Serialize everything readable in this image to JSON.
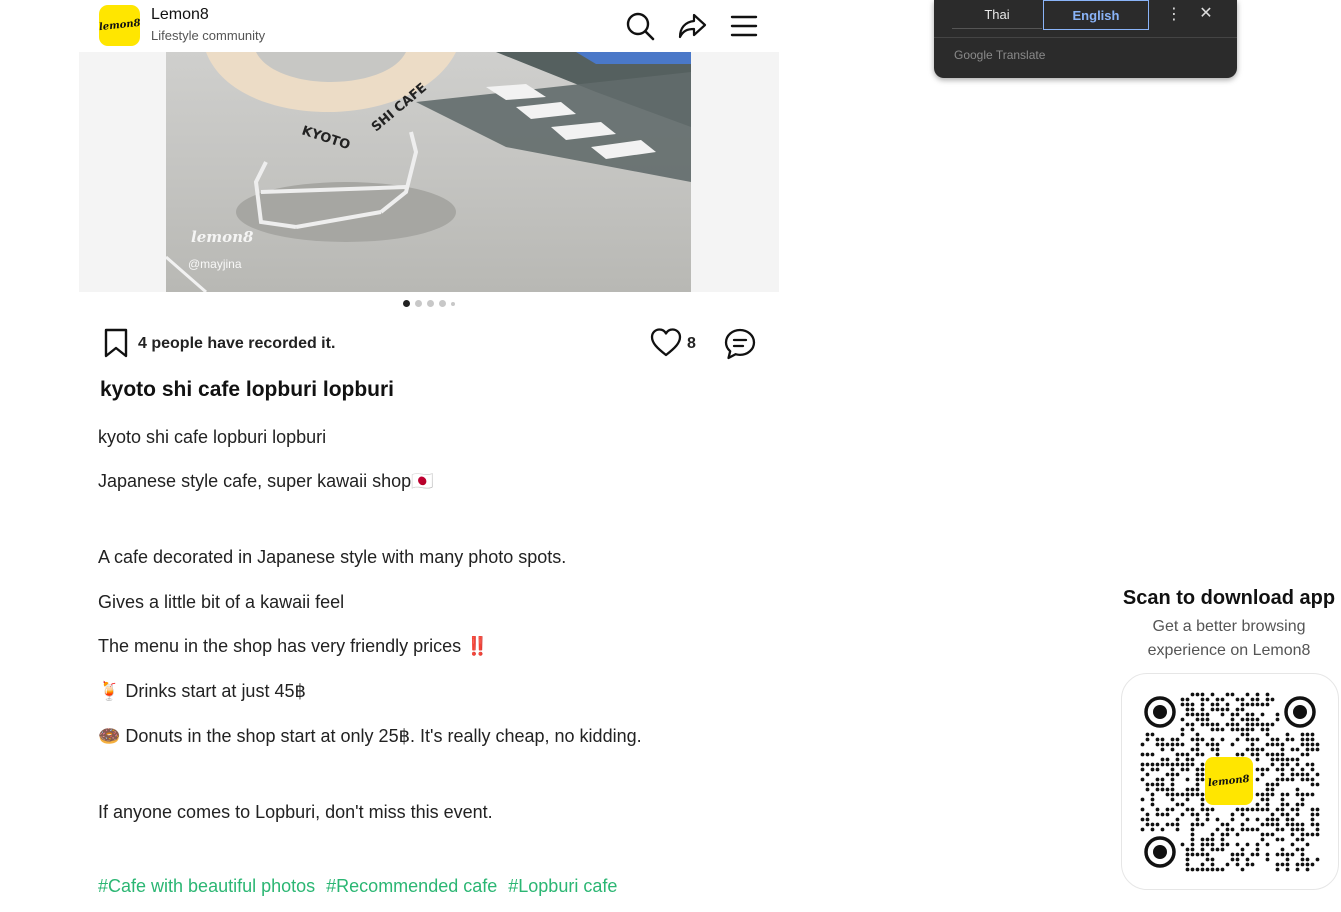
{
  "header": {
    "logo_text": "lemon8",
    "app_name": "Lemon8",
    "app_subtitle": "Lifestyle community"
  },
  "photo": {
    "sign_text": "KYOTO SHI CAFE",
    "watermark": "lemon8",
    "handle": "@mayjina"
  },
  "actions": {
    "recorded_text": "4 people have recorded it.",
    "like_count": "8"
  },
  "post": {
    "title": "kyoto shi cafe lopburi lopburi",
    "lines": [
      "kyoto shi cafe lopburi lopburi",
      "Japanese style cafe, super kawaii shop🇯🇵",
      "A cafe decorated in Japanese style with many photo spots.",
      "Gives a little bit of a kawaii feel",
      "The menu in the shop has very friendly prices ‼️",
      "🍹 Drinks start at just 45฿",
      "🍩 Donuts in the shop start at only 25฿. It's really cheap, no kidding.",
      "If anyone comes to Lopburi, don't miss this event."
    ],
    "tags": [
      "#Cafe with beautiful photos",
      "#Recommended cafe",
      "#Lopburi cafe"
    ]
  },
  "translate": {
    "source_lang": "Thai",
    "target_lang": "English",
    "menu_icon": "⋮",
    "close_icon": "✕",
    "brand": "Google Translate"
  },
  "qr": {
    "title": "Scan to download app",
    "subtitle": "Get a better browsing experience on Lemon8",
    "logo_text": "lemon8"
  },
  "colors": {
    "brand_yellow": "#ffe600",
    "hashtag_green": "#2bb673",
    "translate_bg": "#2b2b2b",
    "translate_accent": "#8ab4f8"
  }
}
